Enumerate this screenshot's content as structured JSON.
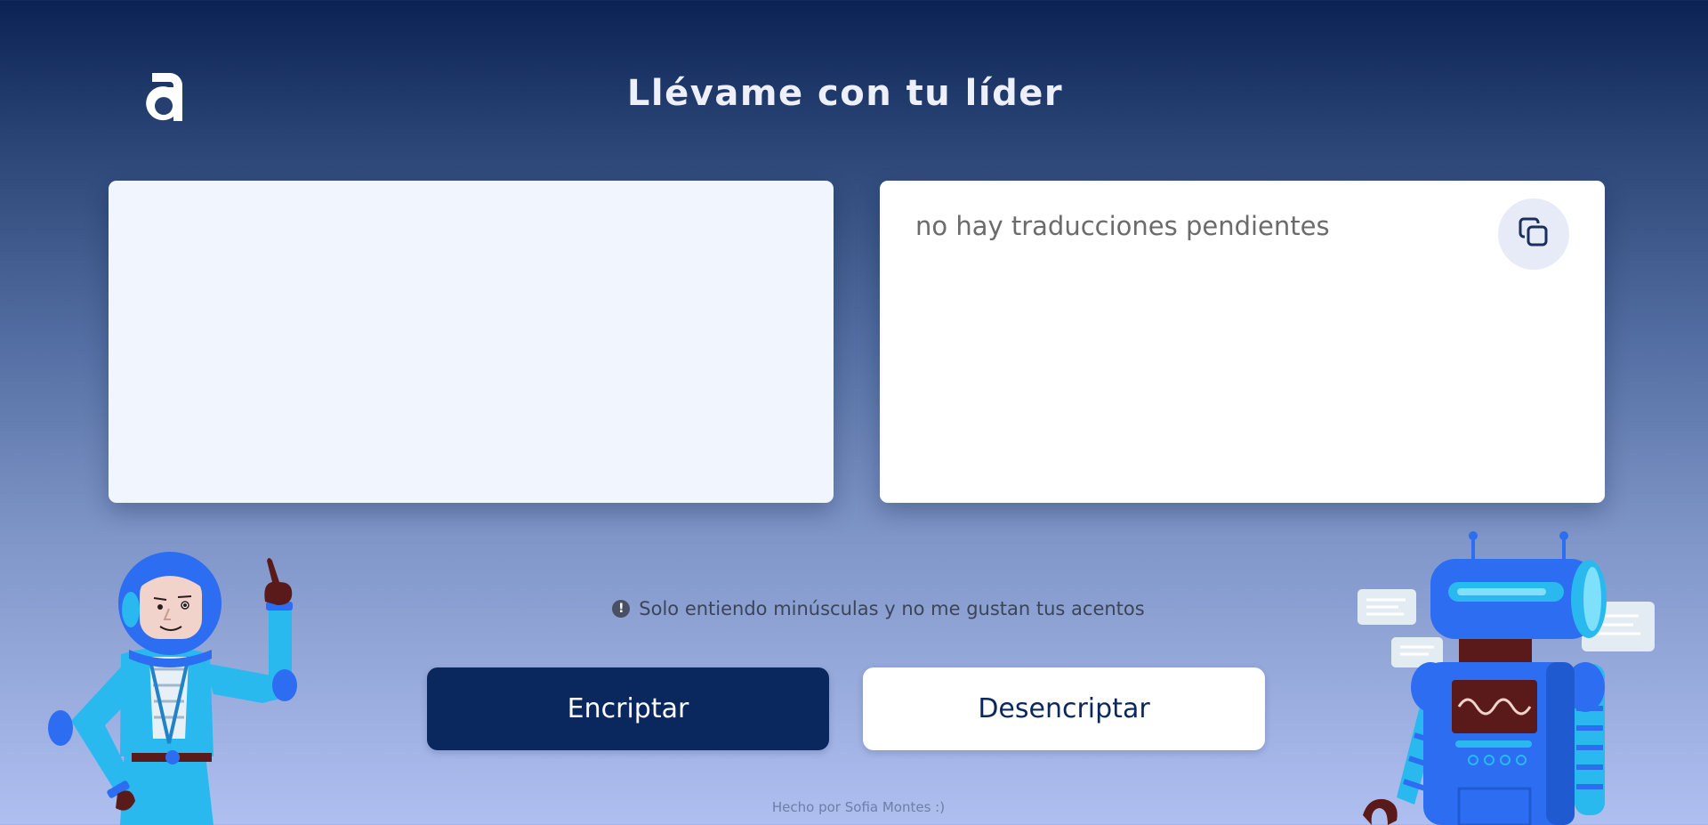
{
  "header": {
    "logo_icon": "letter-a-logo",
    "title": "Llévame con tu líder"
  },
  "input_panel": {
    "value": "",
    "placeholder": ""
  },
  "output_panel": {
    "message": "no hay traducciones pendientes",
    "copy_icon": "copy-icon"
  },
  "hint": {
    "icon": "exclamation-circle-icon",
    "icon_glyph": "!",
    "text": "Solo entiendo minúsculas y no me gustan tus acentos"
  },
  "actions": {
    "encrypt_label": "Encriptar",
    "decrypt_label": "Desencriptar"
  },
  "footer": {
    "credit": "Hecho por Sofia Montes :)"
  },
  "illustrations": {
    "left": "astronaut-illustration",
    "right": "robot-illustration"
  },
  "colors": {
    "background_top": "#0a2354",
    "background_bottom": "#afbff0",
    "primary_button": "#0a285e",
    "secondary_button": "#ffffff",
    "title": "#edf0fb"
  }
}
